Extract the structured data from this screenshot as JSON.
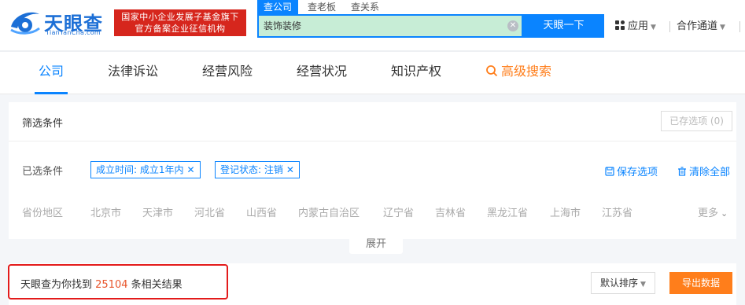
{
  "header": {
    "logo_name": "天眼查",
    "logo_domain": "TianYanCha.com",
    "badge_line1": "国家中小企业发展子基金旗下",
    "badge_line2": "官方备案企业征信机构",
    "search_tabs": [
      "查公司",
      "查老板",
      "查关系"
    ],
    "search_value": "装饰装修",
    "search_button": "天眼一下",
    "app_menu": "应用",
    "partner_menu": "合作通道"
  },
  "nav": {
    "tabs": [
      "公司",
      "法律诉讼",
      "经营风险",
      "经营状况",
      "知识产权"
    ],
    "advanced_search": "高级搜索"
  },
  "filters": {
    "title": "筛选条件",
    "saved_options": "已存选项 (0)",
    "selected_label": "已选条件",
    "chips": [
      "成立时间: 成立1年内",
      "登记状态: 注销"
    ],
    "save_option": "保存选项",
    "clear_all": "清除全部",
    "region_label": "省份地区",
    "regions": [
      "北京市",
      "天津市",
      "河北省",
      "山西省",
      "内蒙古自治区",
      "辽宁省",
      "吉林省",
      "黑龙江省",
      "上海市",
      "江苏省"
    ],
    "more": "更多",
    "expand": "展开"
  },
  "results": {
    "prefix": "天眼查为你找到",
    "count": "25104",
    "suffix": "条相关结果",
    "sort": "默认排序",
    "export": "导出数据"
  },
  "colors": {
    "brand_blue": "#0a84ff",
    "accent_orange": "#ff7e1b",
    "badge_red": "#d6261d",
    "highlight_red": "#e31b1b"
  }
}
